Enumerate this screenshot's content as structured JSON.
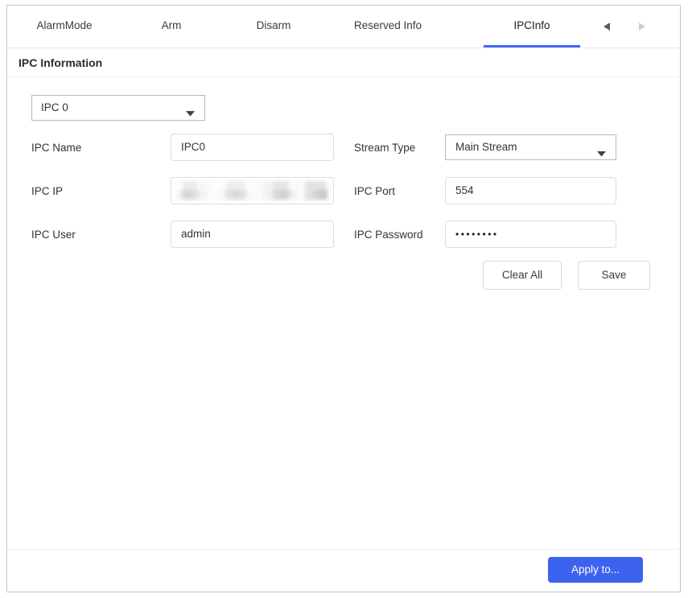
{
  "tabs": {
    "items": [
      {
        "label": "AlarmMode",
        "active": false
      },
      {
        "label": "Arm",
        "active": false
      },
      {
        "label": "Disarm",
        "active": false
      },
      {
        "label": "Reserved Info",
        "active": false
      },
      {
        "label": "IPCInfo",
        "active": true
      }
    ],
    "prev_icon": "triangle-left-icon",
    "next_icon": "triangle-right-icon"
  },
  "section": {
    "title": "IPC Information"
  },
  "channel": {
    "selected": "IPC 0",
    "caret_icon": "chevron-down-icon"
  },
  "form": {
    "ipc_name": {
      "label": "IPC Name",
      "value": "IPC0"
    },
    "ipc_ip": {
      "label": "IPC IP",
      "value": ""
    },
    "ipc_user": {
      "label": "IPC User",
      "value": "admin"
    },
    "stream_type": {
      "label": "Stream Type",
      "value": "Main Stream",
      "caret_icon": "chevron-down-icon"
    },
    "ipc_port": {
      "label": "IPC Port",
      "value": "554"
    },
    "ipc_password": {
      "label": "IPC Password",
      "value": "••••••••"
    }
  },
  "actions": {
    "clear_all": "Clear All",
    "save": "Save"
  },
  "footer": {
    "apply_to": "Apply to..."
  },
  "colors": {
    "accent": "#3d62f0",
    "tab_underline": "#4169f5",
    "border": "#c6c6c6"
  }
}
